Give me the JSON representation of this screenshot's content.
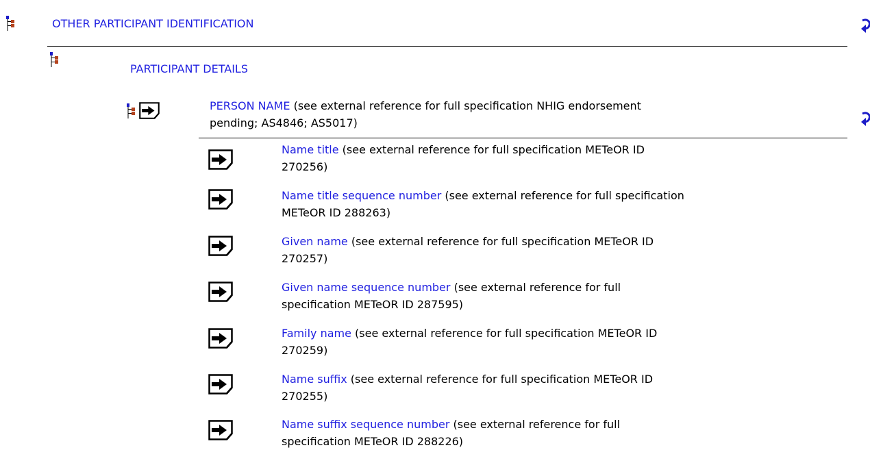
{
  "colors": {
    "link": "#1f1fe0",
    "text": "#000000",
    "tree_blue": "#1c1cc8",
    "tree_red": "#b4431e"
  },
  "sections": {
    "other_participant": {
      "link": "OTHER PARTICIPANT IDENTIFICATION",
      "icon": "hierarchy-icon",
      "return_icon": "return-arrow-icon"
    },
    "participant_details": {
      "link": "PARTICIPANT DETAILS",
      "icon": "hierarchy-icon"
    },
    "person_name": {
      "link": "PERSON NAME",
      "desc_line1": " (see external reference for full specification NHIG endorsement",
      "desc_line2": "pending; AS4846; AS5017)",
      "icons": [
        "hierarchy-icon",
        "document-arrow-icon"
      ],
      "return_icon": "return-arrow-icon"
    }
  },
  "items": [
    {
      "link": "Name title",
      "line1": " (see external reference for full specification METeOR ID",
      "line2": "270256)"
    },
    {
      "link": "Name title sequence number",
      "line1": " (see external reference for full specification",
      "line2": "METeOR ID 288263)"
    },
    {
      "link": "Given name",
      "line1": " (see external reference for full specification METeOR ID",
      "line2": "270257)"
    },
    {
      "link": "Given name sequence number",
      "line1": " (see external reference for full",
      "line2": "specification METeOR ID 287595)"
    },
    {
      "link": "Family name",
      "line1": " (see external reference for full specification METeOR ID",
      "line2": "270259)"
    },
    {
      "link": "Name suffix",
      "line1": " (see external reference for full specification METeOR ID",
      "line2": "270255)"
    },
    {
      "link": "Name suffix sequence number",
      "line1": " (see external reference for full",
      "line2": "specification METeOR ID 288226)"
    }
  ]
}
